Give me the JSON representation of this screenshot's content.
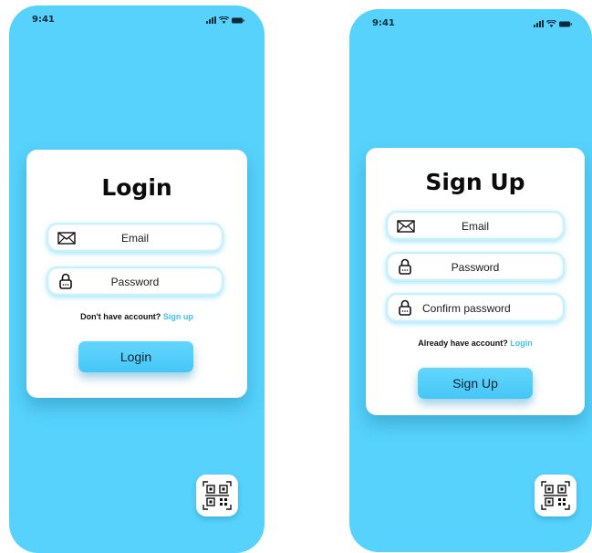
{
  "login_screen": {
    "status_time": "9:41",
    "title": "Login",
    "email_label": "Email",
    "password_label": "Password",
    "prompt_text": "Don't have account?",
    "prompt_link": "Sign up",
    "button_label": "Login"
  },
  "signup_screen": {
    "status_time": "9:41",
    "title": "Sign Up",
    "email_label": "Email",
    "password_label": "Password",
    "confirm_label": "Confirm password",
    "prompt_text": "Already have account?",
    "prompt_link": "Login",
    "button_label": "Sign Up"
  },
  "icons": {
    "email": "mail-icon",
    "password": "lock-icon",
    "qr": "qr-code-icon",
    "signal": "signal-icon",
    "wifi": "wifi-icon",
    "battery": "battery-icon"
  },
  "colors": {
    "background": "#56d2fc",
    "accent_link": "#3fc3f1",
    "button": "#4cc9f8",
    "card": "#ffffff"
  }
}
